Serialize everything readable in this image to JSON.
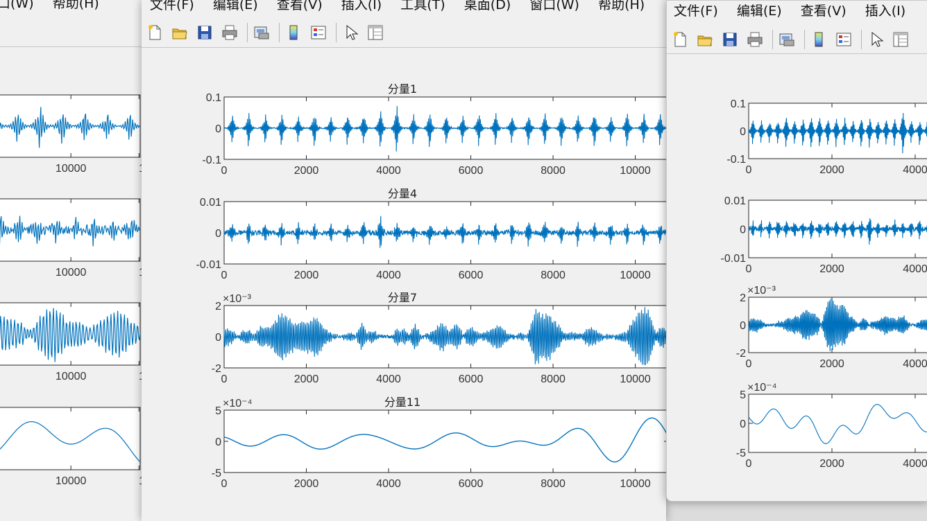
{
  "menus": {
    "left": [
      "口(W)",
      "帮助(H)"
    ],
    "middle": [
      "文件(F)",
      "编辑(E)",
      "查看(V)",
      "插入(I)",
      "工具(T)",
      "桌面(D)",
      "窗口(W)",
      "帮助(H)"
    ],
    "right": [
      "文件(F)",
      "编辑(E)",
      "查看(V)",
      "插入(I)"
    ]
  },
  "toolbar": {
    "icons": [
      "new-file-icon",
      "open-folder-icon",
      "save-icon",
      "print-icon",
      "print-preview-icon",
      "colorbar-icon",
      "legend-icon",
      "pointer-icon",
      "property-inspector-icon"
    ]
  },
  "colors": {
    "line": "#0072BD",
    "window_bg": "#f0f0f0",
    "axes_bg": "#ffffff"
  },
  "middle_plots": [
    {
      "title": "分量1",
      "yticks": [
        "0.1",
        "0",
        "-0.1"
      ],
      "exponent": ""
    },
    {
      "title": "分量4",
      "yticks": [
        "0.01",
        "0",
        "-0.01"
      ],
      "exponent": ""
    },
    {
      "title": "分量7",
      "yticks": [
        "2",
        "0",
        "-2"
      ],
      "exponent": "×10⁻³"
    },
    {
      "title": "分量11",
      "yticks": [
        "5",
        "0",
        "-5"
      ],
      "exponent": "×10⁻⁴"
    }
  ],
  "middle_xticks": [
    "0",
    "2000",
    "4000",
    "6000",
    "8000",
    "10000"
  ],
  "left_xtick": "10000",
  "left_xtick_cut": "1",
  "right_plots": [
    {
      "yticks": [
        "0.1",
        "0",
        "-0.1"
      ],
      "exponent": ""
    },
    {
      "yticks": [
        "0.01",
        "0",
        "-0.01"
      ],
      "exponent": ""
    },
    {
      "yticks": [
        "2",
        "0",
        "-2"
      ],
      "exponent": "×10⁻³"
    },
    {
      "yticks": [
        "5",
        "0",
        "-5"
      ],
      "exponent": "×10⁻⁴"
    }
  ],
  "right_xticks": [
    "0",
    "2000",
    "4000"
  ],
  "chart_data": [
    {
      "type": "line",
      "title": "分量1",
      "xlim": [
        0,
        10700
      ],
      "ylim": [
        -0.1,
        0.1
      ],
      "series": [
        {
          "values": [
            0.06,
            -0.06,
            0.07,
            -0.06,
            0.06,
            -0.07,
            0.1,
            -0.1,
            0.06,
            -0.06
          ]
        }
      ]
    },
    {
      "type": "line",
      "title": "分量4",
      "xlim": [
        0,
        10700
      ],
      "ylim": [
        -0.01,
        0.01
      ],
      "series": [
        {
          "values": [
            0.004,
            -0.004,
            0.006,
            -0.005,
            0.008,
            -0.007,
            0.005,
            -0.005
          ]
        }
      ]
    },
    {
      "type": "line",
      "title": "分量7",
      "xlim": [
        0,
        10700
      ],
      "ylim": [
        -0.002,
        0.002
      ],
      "series": [
        {
          "values": [
            0.0012,
            -0.0012,
            0.0018,
            -0.0022,
            0.0015,
            -0.0015,
            0.0013,
            -0.0013
          ]
        }
      ]
    },
    {
      "type": "line",
      "title": "分量11",
      "xlim": [
        0,
        10700
      ],
      "ylim": [
        -0.0005,
        0.0005
      ],
      "series": [
        {
          "values": [
            0.0001,
            0.0002,
            -0.0002,
            0.0003,
            -0.0003,
            0.0002,
            -0.0001,
            0.0001
          ]
        }
      ]
    }
  ]
}
